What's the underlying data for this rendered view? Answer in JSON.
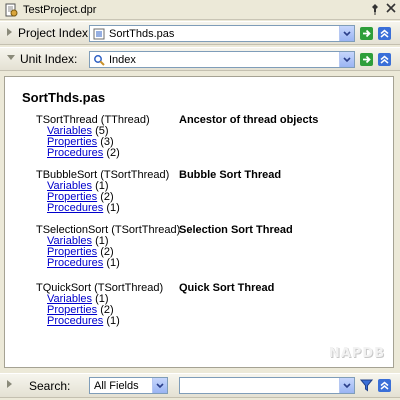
{
  "window": {
    "title": "TestProject.dpr",
    "pin_icon": "pin-icon",
    "close_icon": "close-icon"
  },
  "project_bar": {
    "label": "Project Index:",
    "value": "SortThds.pas"
  },
  "unit_bar": {
    "label": "Unit Index:",
    "value": "Index"
  },
  "content": {
    "heading": "SortThds.pas",
    "units": [
      {
        "name": "TSortThread (TThread)",
        "description": "Ancestor of thread objects",
        "items": [
          {
            "label": "Variables",
            "count": "(5)"
          },
          {
            "label": "Properties",
            "count": "(3)"
          },
          {
            "label": "Procedures",
            "count": "(2)"
          }
        ]
      },
      {
        "name": "TBubbleSort (TSortThread)",
        "description": "Bubble Sort Thread",
        "items": [
          {
            "label": "Variables",
            "count": "(1)"
          },
          {
            "label": "Properties",
            "count": "(2)"
          },
          {
            "label": "Procedures",
            "count": "(1)"
          }
        ]
      },
      {
        "name": "TSelectionSort (TSortThread)",
        "description": "Selection Sort Thread",
        "items": [
          {
            "label": "Variables",
            "count": "(1)"
          },
          {
            "label": "Properties",
            "count": "(2)"
          },
          {
            "label": "Procedures",
            "count": "(1)"
          }
        ]
      },
      {
        "name": "TQuickSort (TSortThread)",
        "description": "Quick Sort Thread",
        "items": [
          {
            "label": "Variables",
            "count": "(1)"
          },
          {
            "label": "Properties",
            "count": "(2)"
          },
          {
            "label": "Procedures",
            "count": "(1)"
          }
        ]
      }
    ],
    "watermark": "NAPDB"
  },
  "search_bar": {
    "label": "Search:",
    "field_value": "All Fields",
    "query_value": ""
  },
  "colors": {
    "link": "#0000cc",
    "go_green": "#2e9e3a",
    "nav_blue": "#3a6fd8",
    "window_bg": "#ece9d8"
  }
}
